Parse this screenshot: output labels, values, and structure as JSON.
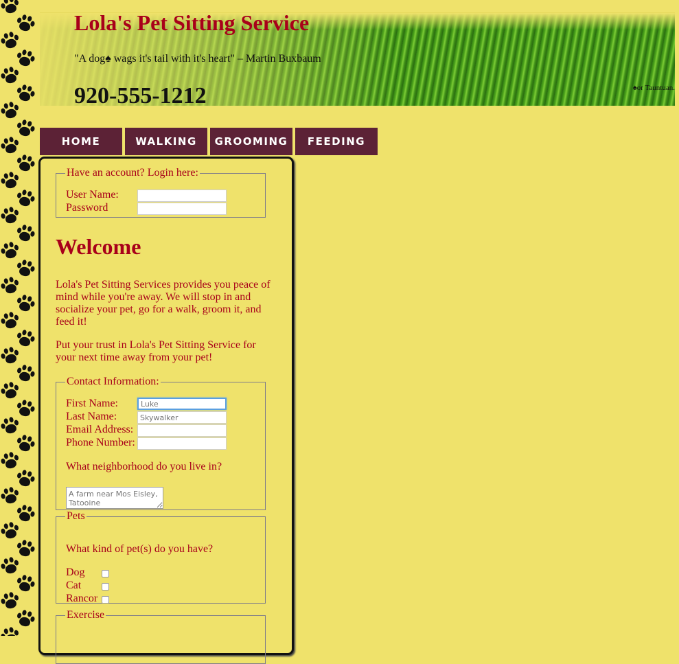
{
  "header": {
    "title": "Lola's Pet Sitting Service",
    "quote": "\"A dog♠ wags it's tail with it's heart\" – Martin Buxbaum",
    "phone": "920-555-1212",
    "footnote": "♠or Tauntuan."
  },
  "nav": [
    {
      "label": "HOME"
    },
    {
      "label": "WALKING"
    },
    {
      "label": "GROOMING"
    },
    {
      "label": "FEEDING"
    }
  ],
  "login": {
    "legend": "Have an account? Login here:",
    "username_label": "User Name:",
    "username_value": "",
    "password_label": "Password",
    "password_value": ""
  },
  "welcome": {
    "heading": "Welcome",
    "p1": "Lola's Pet Sitting Services provides you peace of mind while you're away. We will stop in and socialize your pet, go for a walk, groom it, and feed it!",
    "p2": "Put your trust in Lola's Pet Sitting Service for your next time away from your pet!"
  },
  "contact": {
    "legend": "Contact Information:",
    "first_label": "First Name:",
    "first_placeholder": "Luke",
    "last_label": "Last Name:",
    "last_placeholder": "Skywalker",
    "email_label": "Email Address:",
    "phone_label": "Phone Number:",
    "neighborhood_q": "What neighborhood do you live in?",
    "neighborhood_placeholder": "A farm near Mos Eisley, Tatooine"
  },
  "pets": {
    "legend": "Pets",
    "question": "What kind of pet(s) do you have?",
    "options": [
      {
        "label": "Dog",
        "checked": false
      },
      {
        "label": "Cat",
        "checked": false
      },
      {
        "label": "Rancor",
        "checked": false
      }
    ]
  },
  "exercise": {
    "legend": "Exercise"
  },
  "colors": {
    "background": "#efe26b",
    "accent_text": "#a8001a",
    "nav_bg": "#5c2236"
  }
}
